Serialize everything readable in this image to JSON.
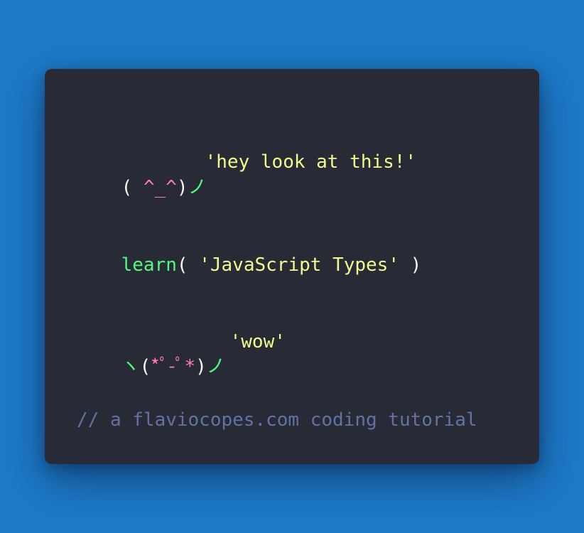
{
  "code": {
    "line1_string": "'hey look at this!'",
    "face1": {
      "open": "( ",
      "eyes": "^_^",
      "close": ")",
      "arm": "ノ"
    },
    "call": {
      "fn": "learn",
      "open_paren": "( ",
      "arg": "'JavaScript Types'",
      "close_paren": " )"
    },
    "line4_string": "'wow'",
    "face2": {
      "left_arm": "ヽ",
      "open": "(",
      "eyes": "*ﾟ-ﾟ*",
      "close": ")",
      "right_arm": "ノ"
    },
    "comment": "// a flaviocopes.com coding tutorial"
  },
  "colors": {
    "background": "#1e7ac7",
    "card": "#282a36",
    "string": "#f1fa8c",
    "function": "#50fa7b",
    "accent": "#ff79c6",
    "text": "#f8f8f2",
    "comment": "#6272a4"
  }
}
